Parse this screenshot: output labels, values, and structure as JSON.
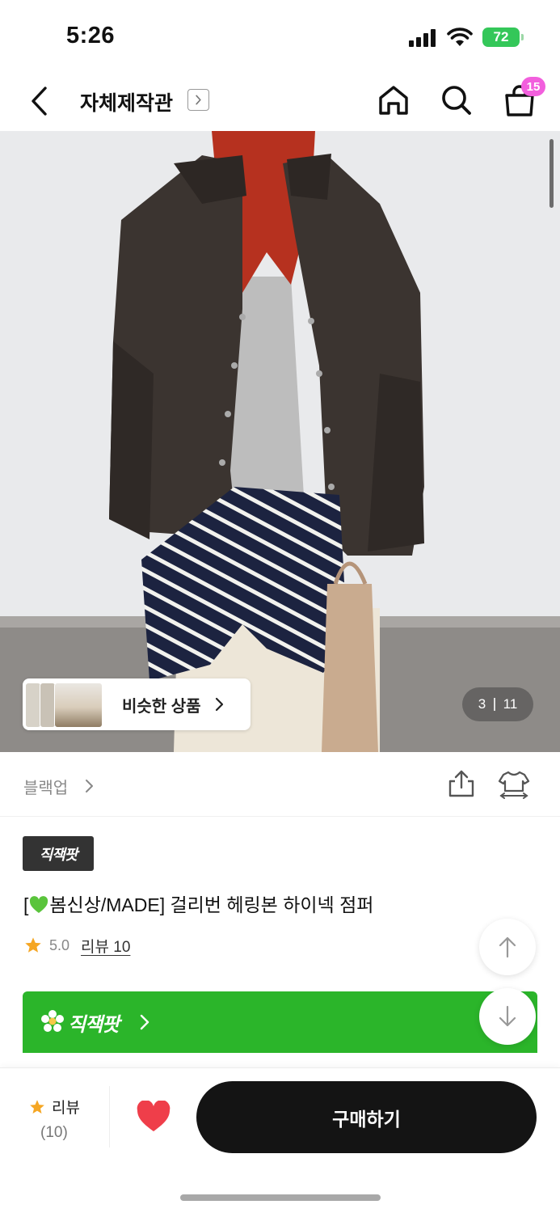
{
  "status_bar": {
    "time": "5:26",
    "battery": "72"
  },
  "header": {
    "shop_title": "자체제작관",
    "cart_count": "15"
  },
  "gallery": {
    "similar_label": "비슷한 상품",
    "current_index": "3",
    "total": "11"
  },
  "category": {
    "label": "블랙업"
  },
  "product": {
    "badge": "직잭팟",
    "title_prefix": "[",
    "title_main": "봄신상/MADE] 걸리번 헤링본 하이넥 점퍼",
    "rating": "5.0",
    "review_link": "리뷰 10"
  },
  "promo": {
    "label": "직잭팟"
  },
  "bottom_bar": {
    "review_label": "리뷰",
    "review_count": "(10)",
    "buy_label": "구매하기"
  },
  "colors": {
    "accent_green": "#2bb52a",
    "cart_badge": "#f25fdd",
    "buy_button": "#141414",
    "star": "#f5a623",
    "like_heart": "#ef3e4a"
  },
  "icons": [
    "back-icon",
    "chevron-right-icon",
    "home-icon",
    "search-icon",
    "shopping-bag-icon",
    "share-icon",
    "size-guide-icon",
    "star-icon",
    "arrow-up-icon",
    "arrow-down-icon",
    "flower-icon",
    "heart-icon",
    "green-heart-icon"
  ]
}
